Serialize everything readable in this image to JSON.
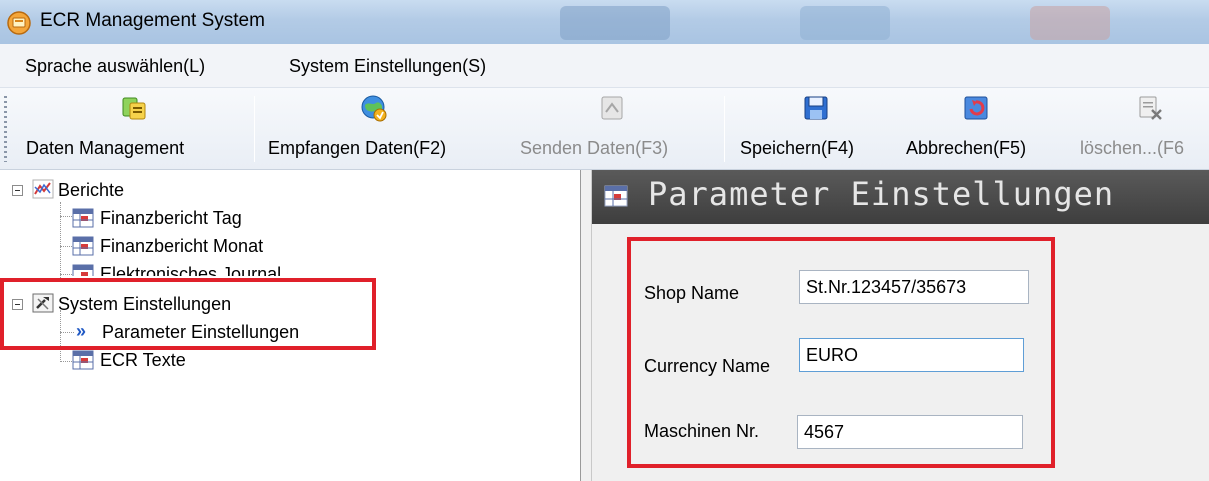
{
  "window": {
    "title": "ECR Management System"
  },
  "menu": [
    {
      "label": "Sprache auswählen(L)"
    },
    {
      "label": "System Einstellungen(S)"
    }
  ],
  "toolbar": {
    "buttons": [
      {
        "label": "Daten Management",
        "icon": "data-management-icon",
        "enabled": true
      },
      {
        "label": "Empfangen Daten(F2)",
        "icon": "receive-globe-icon",
        "enabled": true
      },
      {
        "label": "Senden Daten(F3)",
        "icon": "send-icon",
        "enabled": false
      },
      {
        "label": "Speichern(F4)",
        "icon": "save-floppy-icon",
        "enabled": true
      },
      {
        "label": "Abbrechen(F5)",
        "icon": "cancel-refresh-icon",
        "enabled": true
      },
      {
        "label": "löschen...(F6",
        "icon": "delete-document-icon",
        "enabled": false
      }
    ]
  },
  "tree": {
    "berichte": {
      "label": "Berichte",
      "children": [
        {
          "label": "Finanzbericht Tag"
        },
        {
          "label": "Finanzbericht Monat"
        },
        {
          "label": "Elektronisches Journal"
        }
      ]
    },
    "system": {
      "label": "System Einstellungen",
      "children": [
        {
          "label": "Parameter Einstellungen",
          "selected": true
        },
        {
          "label": "ECR Texte"
        }
      ]
    }
  },
  "panel": {
    "title": "Parameter Einstellungen",
    "fields": {
      "shop_name": {
        "label": "Shop Name",
        "value": "St.Nr.123457/35673"
      },
      "currency_name": {
        "label": "Currency Name",
        "value": "EURO"
      },
      "machine_nr": {
        "label": "Maschinen Nr.",
        "value": "4567"
      }
    }
  },
  "colors": {
    "highlight": "#e0202a",
    "panel_header": "#3e3e3e",
    "titlebar": "#b3cbe6"
  }
}
